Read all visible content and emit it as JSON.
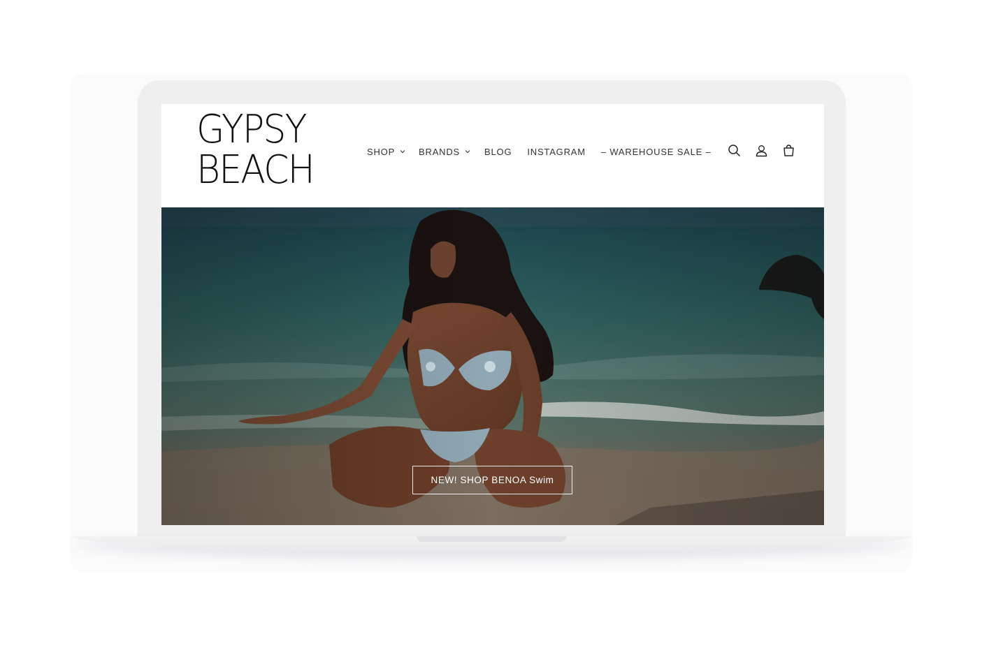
{
  "brand": {
    "logo_line1": "GYPSY",
    "logo_line2": "BEACH"
  },
  "nav": {
    "items": [
      {
        "label": "SHOP",
        "has_dropdown": true
      },
      {
        "label": "BRANDS",
        "has_dropdown": true
      },
      {
        "label": "BLOG",
        "has_dropdown": false
      },
      {
        "label": "INSTAGRAM",
        "has_dropdown": false
      },
      {
        "label": "– WAREHOUSE SALE –",
        "has_dropdown": false
      }
    ]
  },
  "header_icons": [
    "search-icon",
    "account-icon",
    "cart-icon"
  ],
  "hero": {
    "cta_label": "NEW! SHOP BENOA Swim",
    "image_subject": "woman in blue floral bikini crouching on beach"
  },
  "colors": {
    "sea_dark": "#1e3b40",
    "sea_mid": "#3f6b6a",
    "sand": "#8a7a6a",
    "frame": "#efefef"
  }
}
